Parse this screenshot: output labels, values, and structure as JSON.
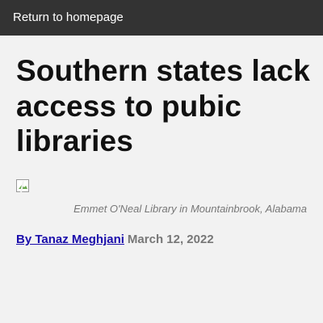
{
  "nav": {
    "home_link": "Return to homepage"
  },
  "article": {
    "title": "Southern states lack access to pubic libraries",
    "image_icon": "broken-image-icon",
    "caption": "Emmet O'Neal Library in Mountainbrook, Alabama",
    "author": "By Tanaz Meghjani",
    "date": "March 12, 2022"
  },
  "colors": {
    "topbar": "#333333",
    "background": "#f2f2f2",
    "link": "#1a0dab",
    "muted": "#777777"
  }
}
